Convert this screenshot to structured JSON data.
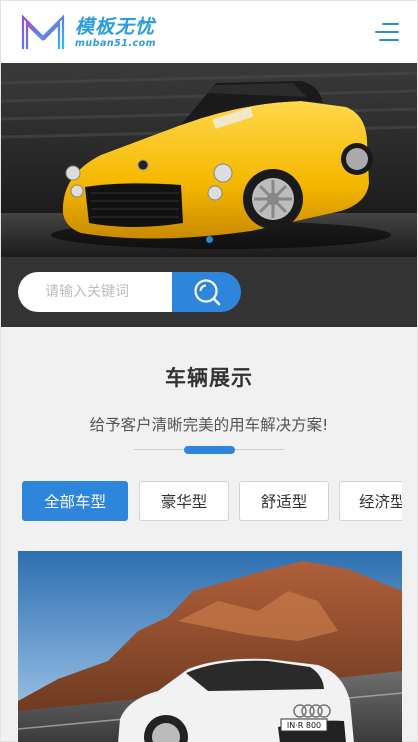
{
  "header": {
    "logo_cn": "模板无忧",
    "logo_en": "muban51.com",
    "menu_icon": "hamburger-menu-icon"
  },
  "banner": {
    "image": "yellow-sports-car",
    "slide_count": 1,
    "active_slide": 1
  },
  "search": {
    "placeholder": "请输入关键词",
    "button_icon": "search-icon"
  },
  "section": {
    "title": "车辆展示",
    "subtitle": "给予客户清晰完美的用车解决方案!"
  },
  "tabs": [
    {
      "label": "全部车型",
      "active": true
    },
    {
      "label": "豪华型",
      "active": false
    },
    {
      "label": "舒适型",
      "active": false
    },
    {
      "label": "经济型",
      "active": false
    }
  ],
  "products": [
    {
      "image": "white-audi-r8-mountain-road",
      "plate": "IN·R 800"
    }
  ],
  "colors": {
    "accent": "#2d86db",
    "logo": "#2a9de0",
    "search_bar_bg": "#333333",
    "page_bg": "#f1f1f1"
  }
}
